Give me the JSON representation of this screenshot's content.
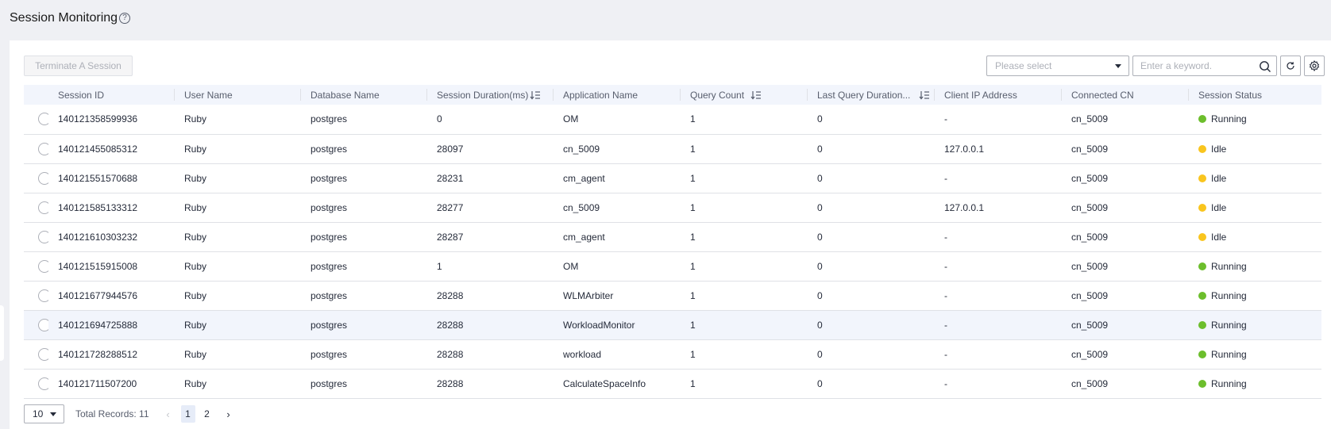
{
  "page": {
    "title": "Session Monitoring",
    "help_glyph": "?"
  },
  "toolbar": {
    "terminate_label": "Terminate A Session",
    "select_placeholder": "Please select",
    "search_placeholder": "Enter a keyword."
  },
  "table": {
    "columns": [
      "Session ID",
      "User Name",
      "Database Name",
      "Session Duration(ms)",
      "Application Name",
      "Query Count",
      "Last Query Duration...",
      "Client IP Address",
      "Connected CN",
      "Session Status"
    ],
    "rows": [
      {
        "session_id": "140121358599936",
        "user": "Ruby",
        "database": "postgres",
        "duration": "0",
        "app": "OM",
        "query_count": "1",
        "last_query": "0",
        "client_ip": "-",
        "cn": "cn_5009",
        "status": "Running"
      },
      {
        "session_id": "140121455085312",
        "user": "Ruby",
        "database": "postgres",
        "duration": "28097",
        "app": "cn_5009",
        "query_count": "1",
        "last_query": "0",
        "client_ip": "127.0.0.1",
        "cn": "cn_5009",
        "status": "Idle"
      },
      {
        "session_id": "140121551570688",
        "user": "Ruby",
        "database": "postgres",
        "duration": "28231",
        "app": "cm_agent",
        "query_count": "1",
        "last_query": "0",
        "client_ip": "-",
        "cn": "cn_5009",
        "status": "Idle"
      },
      {
        "session_id": "140121585133312",
        "user": "Ruby",
        "database": "postgres",
        "duration": "28277",
        "app": "cn_5009",
        "query_count": "1",
        "last_query": "0",
        "client_ip": "127.0.0.1",
        "cn": "cn_5009",
        "status": "Idle"
      },
      {
        "session_id": "140121610303232",
        "user": "Ruby",
        "database": "postgres",
        "duration": "28287",
        "app": "cm_agent",
        "query_count": "1",
        "last_query": "0",
        "client_ip": "-",
        "cn": "cn_5009",
        "status": "Idle"
      },
      {
        "session_id": "140121515915008",
        "user": "Ruby",
        "database": "postgres",
        "duration": "1",
        "app": "OM",
        "query_count": "1",
        "last_query": "0",
        "client_ip": "-",
        "cn": "cn_5009",
        "status": "Running"
      },
      {
        "session_id": "140121677944576",
        "user": "Ruby",
        "database": "postgres",
        "duration": "28288",
        "app": "WLMArbiter",
        "query_count": "1",
        "last_query": "0",
        "client_ip": "-",
        "cn": "cn_5009",
        "status": "Running"
      },
      {
        "session_id": "140121694725888",
        "user": "Ruby",
        "database": "postgres",
        "duration": "28288",
        "app": "WorkloadMonitor",
        "query_count": "1",
        "last_query": "0",
        "client_ip": "-",
        "cn": "cn_5009",
        "status": "Running"
      },
      {
        "session_id": "140121728288512",
        "user": "Ruby",
        "database": "postgres",
        "duration": "28288",
        "app": "workload",
        "query_count": "1",
        "last_query": "0",
        "client_ip": "-",
        "cn": "cn_5009",
        "status": "Running"
      },
      {
        "session_id": "140121711507200",
        "user": "Ruby",
        "database": "postgres",
        "duration": "28288",
        "app": "CalculateSpaceInfo",
        "query_count": "1",
        "last_query": "0",
        "client_ip": "-",
        "cn": "cn_5009",
        "status": "Running"
      }
    ]
  },
  "status_colors": {
    "Running": "#6cbe2c",
    "Idle": "#f9c51e"
  },
  "pager": {
    "page_size": "10",
    "total_label": "Total Records: 11",
    "pages": [
      "1",
      "2"
    ],
    "current_page": "1"
  },
  "icons": [
    "help-icon",
    "chevron-down-icon",
    "search-icon",
    "refresh-icon",
    "settings-icon",
    "sort-icon",
    "chevron-left-icon",
    "chevron-right-icon"
  ]
}
